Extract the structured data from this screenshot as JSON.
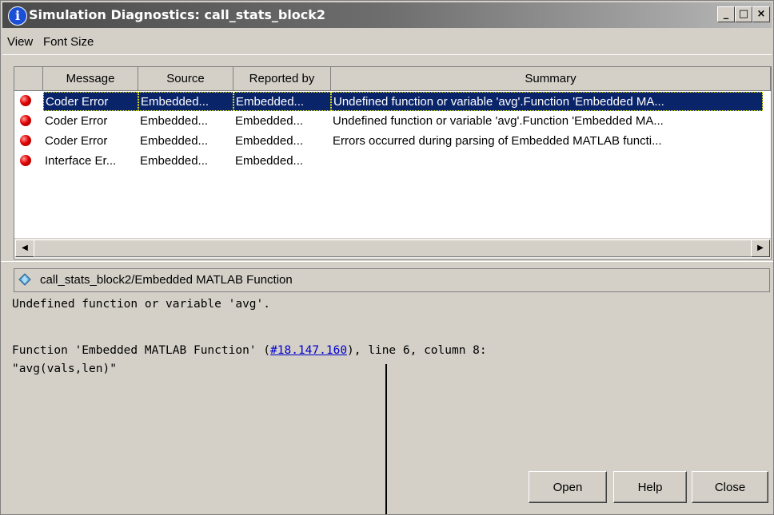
{
  "window": {
    "title": "Simulation Diagnostics: call_stats_block2",
    "controls": {
      "minimize": "_",
      "maximize": "□",
      "close": "×"
    }
  },
  "menu": [
    "View",
    "Font Size"
  ],
  "table": {
    "columns": [
      "",
      "Message",
      "Source",
      "Reported by",
      "Summary"
    ],
    "rows": [
      {
        "icon": "error-icon",
        "message": "Coder Error",
        "source": "Embedded...",
        "reported_by": "Embedded...",
        "summary": "Undefined function or variable 'avg'.Function 'Embedded MA...",
        "selected": true
      },
      {
        "icon": "error-icon",
        "message": "Coder Error",
        "source": "Embedded...",
        "reported_by": "Embedded...",
        "summary": "Undefined function or variable 'avg'.Function 'Embedded MA..."
      },
      {
        "icon": "error-icon",
        "message": "Coder Error",
        "source": "Embedded...",
        "reported_by": "Embedded...",
        "summary": "Errors occurred during parsing of Embedded MATLAB functi..."
      },
      {
        "icon": "error-icon",
        "message": "Interface Er...",
        "source": "Embedded...",
        "reported_by": "Embedded...",
        "summary": ""
      }
    ]
  },
  "source_path": "call_stats_block2/Embedded MATLAB Function",
  "detail": {
    "line1": "Undefined function or variable 'avg'.",
    "line3_prefix": "Function 'Embedded MATLAB Function' (",
    "line3_link": "#18.147.160",
    "line3_suffix": "), line 6, column 8:",
    "line4": "\"avg(vals,len)\""
  },
  "buttons": {
    "open": "Open",
    "help": "Help",
    "close": "Close"
  },
  "colors": {
    "selection": "#0a246a",
    "link": "#0000cc",
    "error": "#e00000"
  }
}
